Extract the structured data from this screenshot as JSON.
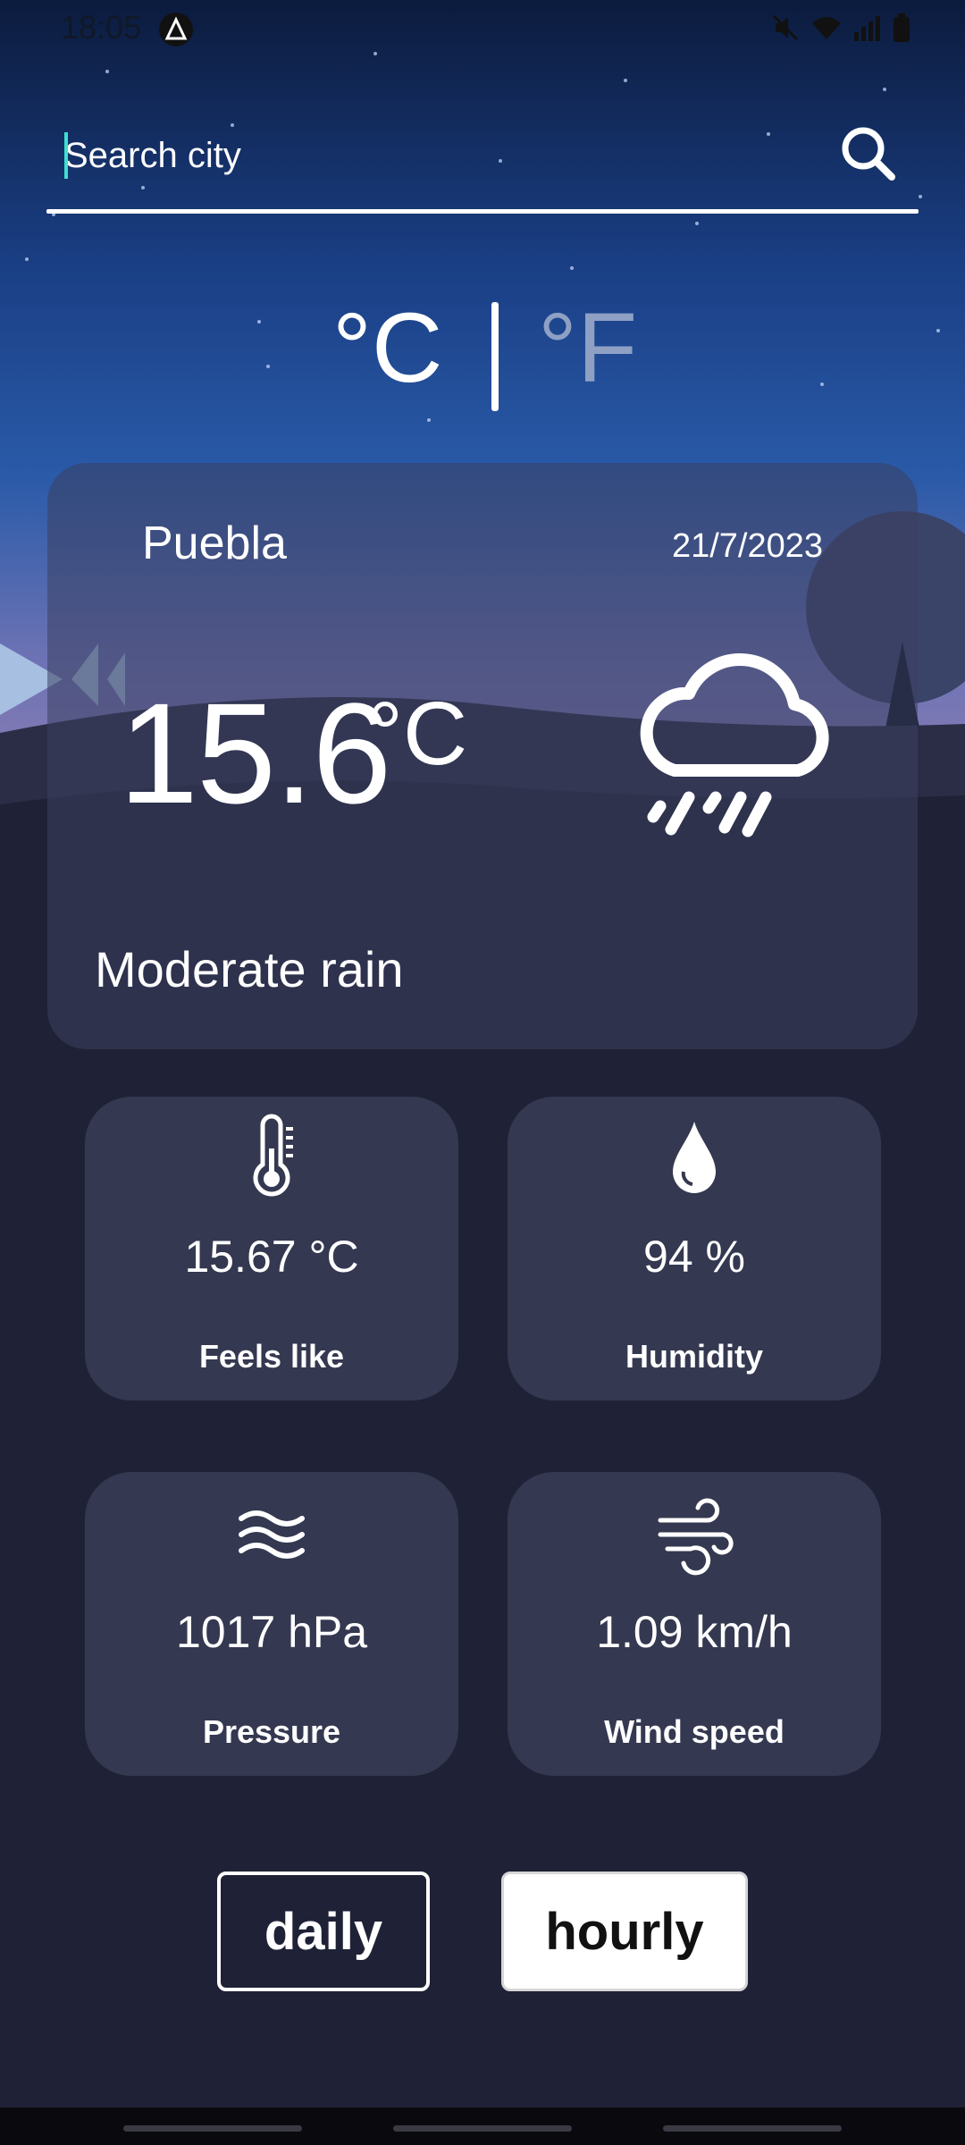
{
  "status_bar": {
    "time": "18:05",
    "icons": [
      "app-notification-icon",
      "mute-icon",
      "wifi-icon",
      "signal-icon",
      "battery-icon"
    ]
  },
  "search": {
    "placeholder": "Search city",
    "value": "",
    "icon": "search-icon"
  },
  "units": {
    "celsius": "°C",
    "fahrenheit": "°F",
    "selected": "celsius"
  },
  "current": {
    "city": "Puebla",
    "date": "21/7/2023",
    "temperature": "15.6",
    "temperature_unit": "°C",
    "condition": "Moderate rain",
    "icon": "cloud-rain-icon"
  },
  "stats": [
    {
      "icon": "thermometer-icon",
      "value": "15.67 °C",
      "label": "Feels like"
    },
    {
      "icon": "droplet-icon",
      "value": "94 %",
      "label": "Humidity"
    },
    {
      "icon": "waves-icon",
      "value": "1017 hPa",
      "label": "Pressure"
    },
    {
      "icon": "wind-icon",
      "value": "1.09 km/h",
      "label": "Wind speed"
    }
  ],
  "buttons": {
    "daily": "daily",
    "hourly": "hourly"
  },
  "colors": {
    "sky_top": "#0c1b3d",
    "sky_mid": "#2458a8",
    "sky_horizon": "#7a78b8",
    "ground": "#1f2236",
    "card": "#343850",
    "caret": "#3de0d0",
    "unit_inactive": "#8ea0c4"
  }
}
